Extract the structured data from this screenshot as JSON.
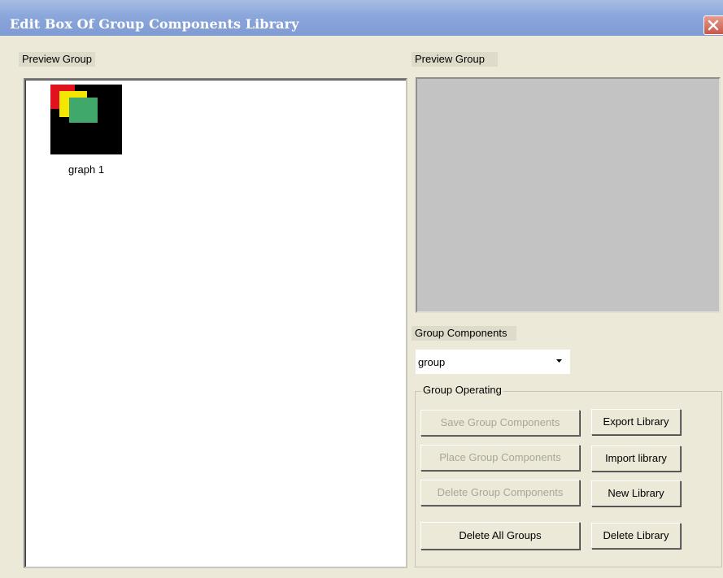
{
  "window": {
    "title": "Edit Box Of Group Components Library"
  },
  "left_panel": {
    "label": "Preview Group",
    "items": [
      {
        "caption": "graph 1"
      }
    ]
  },
  "right_panel": {
    "preview_label": "Preview Group",
    "group_components_label": "Group Components",
    "group_select": {
      "selected": "group"
    }
  },
  "group_operating": {
    "legend": "Group Operating",
    "buttons": {
      "save_components": "Save Group Components",
      "place_components": "Place Group Components",
      "delete_components": "Delete Group Components",
      "delete_all_groups": "Delete All Groups",
      "export_library": "Export Library",
      "import_library": "Import library",
      "new_library": "New Library",
      "delete_library": "Delete Library"
    }
  },
  "colors": {
    "titlebar": "#8aa6da",
    "dialog_bg": "#ece9d8",
    "preview_bg": "#c3c3c3",
    "thumb_red": "#e0121e",
    "thumb_yellow": "#f3e600",
    "thumb_green": "#3fa86a"
  },
  "icons": {
    "close": "close-icon",
    "dropdown": "chevron-down-icon"
  }
}
